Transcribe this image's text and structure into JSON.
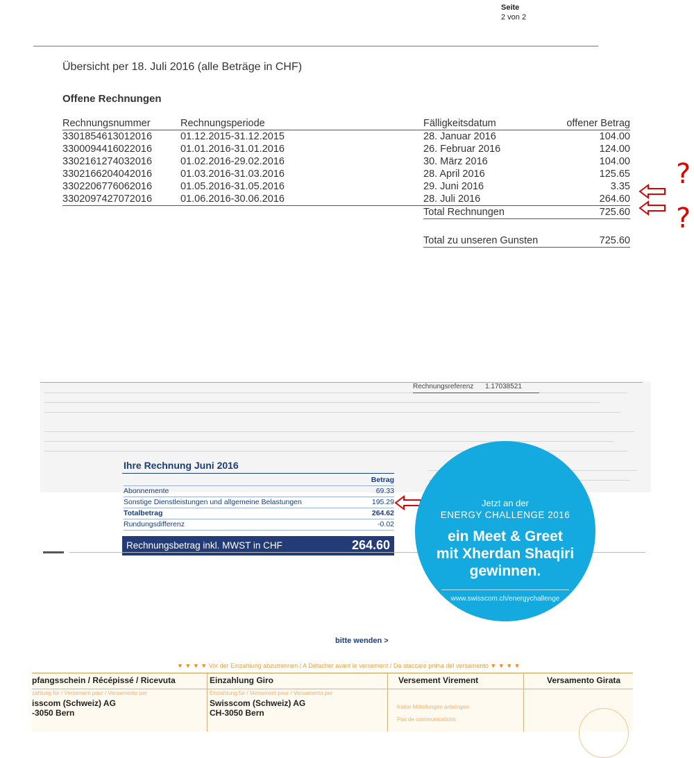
{
  "header": {
    "seite_label": "Seite",
    "seite_value": "2 von 2"
  },
  "overview": {
    "title": "Übersicht per 18. Juli 2016 (alle Beträge in CHF)",
    "section": "Offene Rechnungen",
    "columns": {
      "number": "Rechnungsnummer",
      "period": "Rechnungsperiode",
      "due": "Fälligkeitsdatum",
      "amount": "offener Betrag"
    },
    "rows": [
      {
        "number": "3301854613012016",
        "period": "01.12.2015-31.12.2015",
        "due": "28. Januar 2016",
        "amount": "104.00"
      },
      {
        "number": "3300094416022016",
        "period": "01.01.2016-31.01.2016",
        "due": "26. Februar 2016",
        "amount": "124.00"
      },
      {
        "number": "3302161274032016",
        "period": "01.02.2016-29.02.2016",
        "due": "30. März 2016",
        "amount": "104.00"
      },
      {
        "number": "3302166204042016",
        "period": "01.03.2016-31.03.2016",
        "due": "28. April 2016",
        "amount": "125.65"
      },
      {
        "number": "3302206776062016",
        "period": "01.05.2016-31.05.2016",
        "due": "29. Juni 2016",
        "amount": "3.35"
      },
      {
        "number": "3302097427072016",
        "period": "01.06.2016-30.06.2016",
        "due": "28. Juli 2016",
        "amount": "264.60"
      }
    ],
    "total_label": "Total Rechnungen",
    "total_value": "725.60",
    "grand_label": "Total zu unseren Gunsten",
    "grand_value": "725.60"
  },
  "annotations": {
    "question_mark": "?",
    "arrow_color": "#e00000"
  },
  "reference": {
    "label": "Rechnungsreferenz",
    "value": "1.17038521"
  },
  "bill": {
    "title": "Ihre Rechnung Juni 2016",
    "amount_header": "Betrag",
    "lines": [
      {
        "label": "Abonnemente",
        "amount": "69.33"
      },
      {
        "label": "Sonstige Dienstleistungen und allgemeine Belastungen",
        "amount": "195.29"
      },
      {
        "label": "Totalbetrag",
        "amount": "264.62"
      },
      {
        "label": "Rundungsdifferenz",
        "amount": "-0.02"
      }
    ],
    "final_label": "Rechnungsbetrag inkl. MWST in CHF",
    "final_value": "264.60",
    "accent_color": "#233c78"
  },
  "promo": {
    "line1": "Jetzt an der",
    "line2": "ENERGY CHALLENGE 2016",
    "headline1": "ein Meet & Greet",
    "headline2": "mit Xherdan Shaqiri",
    "headline3": "gewinnen.",
    "url": "www.swisscom.ch/energychallenge",
    "color": "#14a9df"
  },
  "bitte_wenden": "bitte wenden >",
  "cut_notice": "Vor der Einzahlung abzutrennen / A Détacher avant le versement / Da staccare prima del versamento",
  "slip": {
    "col1_title": "pfangsschein / Récépissé / Ricevuta",
    "col1_small": "zahlung für / Versement pour / Versamento per",
    "col1_addr1": "isscom (Schweiz) AG",
    "col1_addr2": "-3050 Bern",
    "col2_title": "Einzahlung Giro",
    "col2_small": "Einzahlung für / Versement pour / Versamento per",
    "col2_addr1": "Swisscom (Schweiz) AG",
    "col2_addr2": "CH-3050 Bern",
    "col3_title": "Versement Virement",
    "col3_small1": "Keine Mitteilungen anbringen",
    "col3_small2": "Pas de communications",
    "col4_title": "Versamento Girata"
  }
}
